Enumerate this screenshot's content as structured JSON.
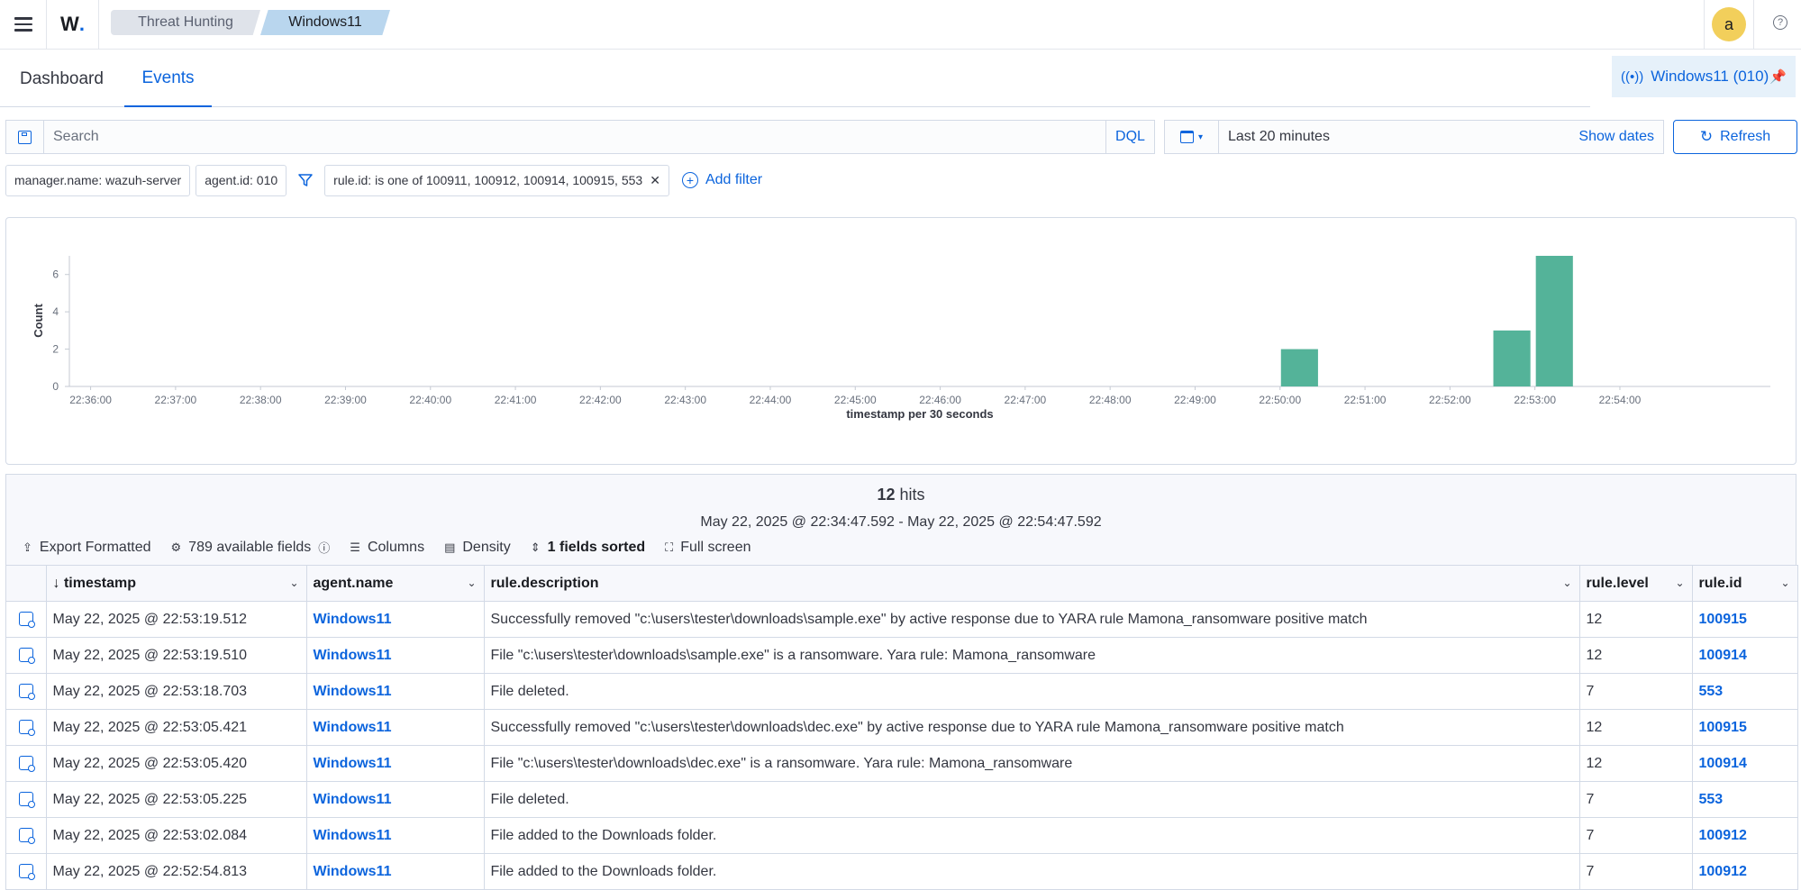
{
  "topbar": {
    "logo_text": "W",
    "breadcrumbs": [
      "Threat Hunting",
      "Windows11"
    ],
    "avatar_initial": "a",
    "help_icon": "?"
  },
  "tabs": {
    "dashboard": "Dashboard",
    "events": "Events",
    "active": "events"
  },
  "agent_pin": {
    "label": "Windows11 (010)"
  },
  "search": {
    "placeholder": "Search",
    "query_language": "DQL"
  },
  "time": {
    "range": "Last 20 minutes",
    "show_dates": "Show dates",
    "refresh": "Refresh"
  },
  "filters": {
    "pills": [
      "manager.name: wazuh-server",
      "agent.id: 010"
    ],
    "rule_filter": "rule.id: is one of 100911, 100912, 100914, 100915, 553",
    "add_filter": "Add filter"
  },
  "chart_data": {
    "type": "bar",
    "ylabel": "Count",
    "xlabel": "timestamp per 30 seconds",
    "ylim": [
      0,
      7
    ],
    "yticks": [
      0,
      2,
      4,
      6
    ],
    "xticks": [
      "22:36:00",
      "22:37:00",
      "22:38:00",
      "22:39:00",
      "22:40:00",
      "22:41:00",
      "22:42:00",
      "22:43:00",
      "22:44:00",
      "22:45:00",
      "22:46:00",
      "22:47:00",
      "22:48:00",
      "22:49:00",
      "22:50:00",
      "22:51:00",
      "22:52:00",
      "22:53:00",
      "22:54:00"
    ],
    "bars": [
      {
        "x": "22:50:00",
        "value": 2
      },
      {
        "x": "22:52:30",
        "value": 3
      },
      {
        "x": "22:53:00",
        "value": 7
      }
    ],
    "color": "#54b399"
  },
  "results": {
    "hits_count": "12",
    "hits_label": "hits",
    "range_text": "May 22, 2025 @ 22:34:47.592 - May 22, 2025 @ 22:54:47.592",
    "toolbar": {
      "export": "Export Formatted",
      "fields": "789 available fields",
      "columns": "Columns",
      "density": "Density",
      "sorted": "1 fields sorted",
      "fullscreen": "Full screen"
    },
    "columns": [
      "timestamp",
      "agent.name",
      "rule.description",
      "rule.level",
      "rule.id"
    ],
    "rows": [
      {
        "timestamp": "May 22, 2025 @ 22:53:19.512",
        "agent": "Windows11",
        "description": "Successfully removed \"c:\\users\\tester\\downloads\\sample.exe\" by active response due to YARA rule Mamona_ransomware positive match",
        "level": "12",
        "rule_id": "100915"
      },
      {
        "timestamp": "May 22, 2025 @ 22:53:19.510",
        "agent": "Windows11",
        "description": "File \"c:\\users\\tester\\downloads\\sample.exe\" is a ransomware. Yara rule: Mamona_ransomware",
        "level": "12",
        "rule_id": "100914"
      },
      {
        "timestamp": "May 22, 2025 @ 22:53:18.703",
        "agent": "Windows11",
        "description": "File deleted.",
        "level": "7",
        "rule_id": "553"
      },
      {
        "timestamp": "May 22, 2025 @ 22:53:05.421",
        "agent": "Windows11",
        "description": "Successfully removed \"c:\\users\\tester\\downloads\\dec.exe\" by active response due to YARA rule Mamona_ransomware positive match",
        "level": "12",
        "rule_id": "100915"
      },
      {
        "timestamp": "May 22, 2025 @ 22:53:05.420",
        "agent": "Windows11",
        "description": "File \"c:\\users\\tester\\downloads\\dec.exe\" is a ransomware. Yara rule: Mamona_ransomware",
        "level": "12",
        "rule_id": "100914"
      },
      {
        "timestamp": "May 22, 2025 @ 22:53:05.225",
        "agent": "Windows11",
        "description": "File deleted.",
        "level": "7",
        "rule_id": "553"
      },
      {
        "timestamp": "May 22, 2025 @ 22:53:02.084",
        "agent": "Windows11",
        "description": "File added to the Downloads folder.",
        "level": "7",
        "rule_id": "100912"
      },
      {
        "timestamp": "May 22, 2025 @ 22:52:54.813",
        "agent": "Windows11",
        "description": "File added to the Downloads folder.",
        "level": "7",
        "rule_id": "100912"
      }
    ]
  },
  "colors": {
    "accent": "#0b64dd",
    "bar": "#54b399",
    "avatar": "#f2cf5b"
  }
}
